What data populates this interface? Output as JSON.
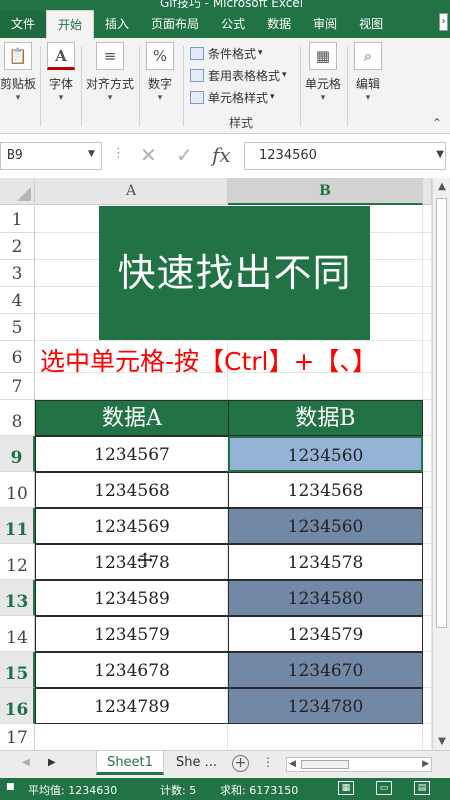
{
  "window": {
    "title": "Gif技巧 - Microsoft Excel"
  },
  "ribbon": {
    "tabs": [
      "文件",
      "开始",
      "插入",
      "页面布局",
      "公式",
      "数据",
      "审阅",
      "视图"
    ],
    "active_tab": "开始",
    "more": "›",
    "groups": {
      "clipboard": "剪贴板",
      "font": "字体",
      "alignment": "对齐方式",
      "number": "数字",
      "cells": "单元格",
      "editing": "编辑"
    },
    "styles": {
      "items": [
        "条件格式",
        "套用表格格式",
        "单元格样式"
      ],
      "caption": "样式"
    }
  },
  "formula_bar": {
    "name_box": "B9",
    "formula": "1234560"
  },
  "grid": {
    "columns": [
      "A",
      "B"
    ],
    "selected_column": "B",
    "rows": [
      "1",
      "2",
      "3",
      "4",
      "5",
      "6",
      "7",
      "8",
      "9",
      "10",
      "11",
      "12",
      "13",
      "14",
      "15",
      "16",
      "17"
    ],
    "highlighted_rows": [
      "9",
      "11",
      "13",
      "15",
      "16"
    ],
    "banner": "快速找出不同",
    "instruction": "选中单元格-按【Ctrl】+【、】",
    "table": {
      "headers": [
        "数据A",
        "数据B"
      ],
      "rows": [
        {
          "a": "1234567",
          "b": "1234560",
          "diff": true
        },
        {
          "a": "1234568",
          "b": "1234568",
          "diff": false
        },
        {
          "a": "1234569",
          "b": "1234560",
          "diff": true
        },
        {
          "a": "1234578",
          "b": "1234578",
          "diff": false
        },
        {
          "a": "1234589",
          "b": "1234580",
          "diff": true
        },
        {
          "a": "1234579",
          "b": "1234579",
          "diff": false
        },
        {
          "a": "1234678",
          "b": "1234670",
          "diff": true
        },
        {
          "a": "1234789",
          "b": "1234780",
          "diff": true
        }
      ]
    }
  },
  "sheets": {
    "tabs": [
      "Sheet1",
      "She ..."
    ],
    "active": "Sheet1",
    "more": "⋮"
  },
  "status": {
    "average": "平均值: 1234630",
    "count": "计数: 5",
    "sum": "求和: 6173150"
  },
  "colors": {
    "accent": "#217346",
    "diff_fill": "#7189a6",
    "active_fill": "#95b3d7",
    "instruction_red": "#ff0000"
  }
}
